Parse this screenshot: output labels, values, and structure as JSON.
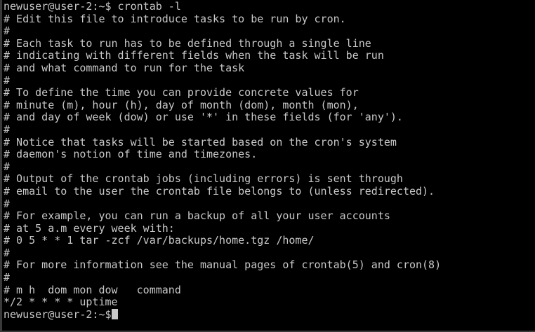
{
  "terminal": {
    "text_color": "#c8c8c8",
    "background_color": "#000000",
    "lines": [
      "newuser@user-2:~$ crontab -l",
      "# Edit this file to introduce tasks to be run by cron.",
      "#",
      "# Each task to run has to be defined through a single line",
      "# indicating with different fields when the task will be run",
      "# and what command to run for the task",
      "#",
      "# To define the time you can provide concrete values for",
      "# minute (m), hour (h), day of month (dom), month (mon),",
      "# and day of week (dow) or use '*' in these fields (for 'any').",
      "#",
      "# Notice that tasks will be started based on the cron's system",
      "# daemon's notion of time and timezones.",
      "#",
      "# Output of the crontab jobs (including errors) is sent through",
      "# email to the user the crontab file belongs to (unless redirected).",
      "#",
      "# For example, you can run a backup of all your user accounts",
      "# at 5 a.m every week with:",
      "# 0 5 * * 1 tar -zcf /var/backups/home.tgz /home/",
      "#",
      "# For more information see the manual pages of crontab(5) and cron(8)",
      "#",
      "# m h  dom mon dow   command",
      "*/2 * * * * uptime"
    ],
    "prompt": "newuser@user-2:~$"
  }
}
